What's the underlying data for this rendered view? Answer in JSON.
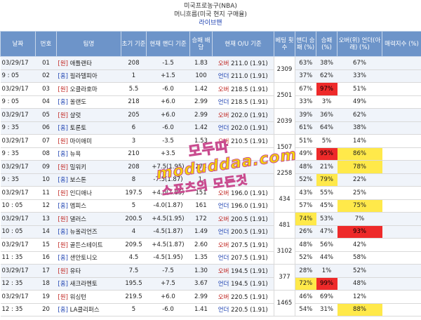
{
  "header": {
    "title": "미국프로농구(NBA)",
    "subtitle": "머니흐름(미국 현지 구매율)",
    "link": "라이브맨"
  },
  "columns": [
    "날짜",
    "번호",
    "팀명",
    "초기 기준",
    "현재 핸디 기준",
    "승패 배당",
    "현재 O/U 기준",
    "베팅 횟수",
    "핸디 승패 (%)",
    "승패 (%)",
    "오버(위) 언더(아래) (%)",
    "매력지수 (%)"
  ],
  "rows": [
    {
      "date": "03/29/17",
      "no": "01",
      "tag": "[원]",
      "team": "애틀랜타",
      "init": "208",
      "handi": "-1.5",
      "odds": "1.83",
      "ou_type": "오버",
      "ou": "211.0 (1.91)",
      "bets": "2309",
      "h_pct": "63%",
      "wl_pct": "38%",
      "ou_pct": "67%",
      "attr": "",
      "hl": {}
    },
    {
      "date": "9 : 05",
      "no": "02",
      "tag": "[홈]",
      "team": "필라델피아",
      "init": "1",
      "handi": "+1.5",
      "odds": "100",
      "ou_type": "언더",
      "ou": "211.0 (1.91)",
      "bets": "",
      "h_pct": "37%",
      "wl_pct": "62%",
      "ou_pct": "33%",
      "attr": "",
      "hl": {}
    },
    {
      "date": "03/29/17",
      "no": "03",
      "tag": "[원]",
      "team": "오클라호마",
      "init": "5.5",
      "handi": "-6.0",
      "odds": "1.42",
      "ou_type": "오버",
      "ou": "218.5 (1.91)",
      "bets": "2501",
      "h_pct": "67%",
      "wl_pct": "97%",
      "ou_pct": "51%",
      "attr": "",
      "hl": {
        "wl_pct": "r"
      }
    },
    {
      "date": "9 : 05",
      "no": "04",
      "tag": "[홈]",
      "team": "올랜도",
      "init": "218",
      "handi": "+6.0",
      "odds": "2.99",
      "ou_type": "언더",
      "ou": "218.5 (1.91)",
      "bets": "",
      "h_pct": "33%",
      "wl_pct": "3%",
      "ou_pct": "49%",
      "attr": "",
      "hl": {}
    },
    {
      "date": "03/29/17",
      "no": "05",
      "tag": "[원]",
      "team": "샬럿",
      "init": "205",
      "handi": "+6.0",
      "odds": "2.99",
      "ou_type": "오버",
      "ou": "202.0 (1.91)",
      "bets": "2039",
      "h_pct": "39%",
      "wl_pct": "36%",
      "ou_pct": "62%",
      "attr": "",
      "hl": {}
    },
    {
      "date": "9 : 35",
      "no": "06",
      "tag": "[홈]",
      "team": "토론토",
      "init": "6",
      "handi": "-6.0",
      "odds": "1.42",
      "ou_type": "언더",
      "ou": "202.0 (1.91)",
      "bets": "",
      "h_pct": "61%",
      "wl_pct": "64%",
      "ou_pct": "38%",
      "attr": "",
      "hl": {}
    },
    {
      "date": "03/29/17",
      "no": "07",
      "tag": "[원]",
      "team": "마이애미",
      "init": "3",
      "handi": "-3.5",
      "odds": "1.53",
      "ou_type": "오버",
      "ou": "210.5 (1.91)",
      "bets": "1507",
      "h_pct": "51%",
      "wl_pct": "5%",
      "ou_pct": "14%",
      "attr": "",
      "hl": {}
    },
    {
      "date": "9 : 35",
      "no": "08",
      "tag": "[홈]",
      "team": "뉴욕",
      "init": "210",
      "handi": "+3.5",
      "odds": "",
      "ou_type": "",
      "ou": "",
      "bets": "",
      "h_pct": "49%",
      "wl_pct": "95%",
      "ou_pct": "86%",
      "attr": "",
      "hl": {
        "wl_pct": "r",
        "ou_pct": "y"
      }
    },
    {
      "date": "03/29/17",
      "no": "09",
      "tag": "[원]",
      "team": "밀워키",
      "init": "208",
      "handi": "+7.5(1.95)",
      "odds": "274",
      "ou_type": "",
      "ou": "",
      "bets": "2258",
      "h_pct": "48%",
      "wl_pct": "21%",
      "ou_pct": "78%",
      "attr": "",
      "hl": {
        "ou_pct": "y"
      }
    },
    {
      "date": "9 : 35",
      "no": "10",
      "tag": "[홈]",
      "team": "보스톤",
      "init": "8",
      "handi": "-7.5(1.87)",
      "odds": "1.",
      "ou_type": "",
      "ou": "",
      "bets": "",
      "h_pct": "52%",
      "wl_pct": "79%",
      "ou_pct": "22%",
      "attr": "",
      "hl": {
        "wl_pct": "y"
      }
    },
    {
      "date": "03/29/17",
      "no": "11",
      "tag": "[원]",
      "team": "인디애나",
      "init": "197.5",
      "handi": "+4.0(1.85)",
      "odds": "151",
      "ou_type": "오버",
      "ou": "196.0 (1.91)",
      "bets": "434",
      "h_pct": "43%",
      "wl_pct": "55%",
      "ou_pct": "25%",
      "attr": "",
      "hl": {}
    },
    {
      "date": "10 : 05",
      "no": "12",
      "tag": "[홈]",
      "team": "멤피스",
      "init": "5",
      "handi": "-4.0(1.87)",
      "odds": "161",
      "ou_type": "언더",
      "ou": "196.0 (1.91)",
      "bets": "",
      "h_pct": "57%",
      "wl_pct": "45%",
      "ou_pct": "75%",
      "attr": "",
      "hl": {
        "ou_pct": "y"
      }
    },
    {
      "date": "03/29/17",
      "no": "13",
      "tag": "[원]",
      "team": "댈러스",
      "init": "200.5",
      "handi": "+4.5(1.95)",
      "odds": "172",
      "ou_type": "오버",
      "ou": "200.5 (1.91)",
      "bets": "481",
      "h_pct": "74%",
      "wl_pct": "53%",
      "ou_pct": "7%",
      "attr": "",
      "hl": {
        "h_pct": "y"
      }
    },
    {
      "date": "10 : 05",
      "no": "14",
      "tag": "[홈]",
      "team": "뉴올리언즈",
      "init": "4",
      "handi": "-4.5(1.87)",
      "odds": "1.49",
      "ou_type": "언더",
      "ou": "200.5 (1.91)",
      "bets": "",
      "h_pct": "26%",
      "wl_pct": "47%",
      "ou_pct": "93%",
      "attr": "",
      "hl": {
        "ou_pct": "r"
      }
    },
    {
      "date": "03/29/17",
      "no": "15",
      "tag": "[원]",
      "team": "골든스테이트",
      "init": "209.5",
      "handi": "+4.5(1.87)",
      "odds": "2.60",
      "ou_type": "오버",
      "ou": "207.5 (1.91)",
      "bets": "3102",
      "h_pct": "48%",
      "wl_pct": "56%",
      "ou_pct": "42%",
      "attr": "",
      "hl": {}
    },
    {
      "date": "11 : 35",
      "no": "16",
      "tag": "[홈]",
      "team": "샌안토니오",
      "init": "4.5",
      "handi": "-4.5(1.95)",
      "odds": "1.35",
      "ou_type": "언더",
      "ou": "207.5 (1.91)",
      "bets": "",
      "h_pct": "52%",
      "wl_pct": "44%",
      "ou_pct": "58%",
      "attr": "",
      "hl": {}
    },
    {
      "date": "03/29/17",
      "no": "17",
      "tag": "[원]",
      "team": "유타",
      "init": "7.5",
      "handi": "-7.5",
      "odds": "1.30",
      "ou_type": "오버",
      "ou": "194.5 (1.91)",
      "bets": "377",
      "h_pct": "28%",
      "wl_pct": "1%",
      "ou_pct": "52%",
      "attr": "",
      "hl": {}
    },
    {
      "date": "12 : 35",
      "no": "18",
      "tag": "[홈]",
      "team": "새크라멘토",
      "init": "195.5",
      "handi": "+7.5",
      "odds": "3.67",
      "ou_type": "언더",
      "ou": "194.5 (1.91)",
      "bets": "",
      "h_pct": "72%",
      "wl_pct": "99%",
      "ou_pct": "48%",
      "attr": "",
      "hl": {
        "h_pct": "y",
        "wl_pct": "r"
      }
    },
    {
      "date": "03/29/17",
      "no": "19",
      "tag": "[원]",
      "team": "워싱턴",
      "init": "219.5",
      "handi": "+6.0",
      "odds": "2.99",
      "ou_type": "오버",
      "ou": "220.5 (1.91)",
      "bets": "1465",
      "h_pct": "46%",
      "wl_pct": "69%",
      "ou_pct": "12%",
      "attr": "",
      "hl": {}
    },
    {
      "date": "12 : 35",
      "no": "20",
      "tag": "[홈]",
      "team": "LA클리퍼스",
      "init": "5",
      "handi": "-6.0",
      "odds": "1.41",
      "ou_type": "언더",
      "ou": "220.5 (1.91)",
      "bets": "",
      "h_pct": "54%",
      "wl_pct": "31%",
      "ou_pct": "88%",
      "attr": "",
      "hl": {
        "ou_pct": "y"
      }
    }
  ],
  "watermark": {
    "line1": "모두따",
    "line2": "moduddaa.com",
    "line3": "스포츠의 모든것"
  },
  "colors": {
    "header_bg": "#6d94c9",
    "highlight_yellow": "#ffe94a",
    "highlight_red": "#ee2a2a",
    "over": "#c0241f",
    "under": "#1a3fb0"
  }
}
